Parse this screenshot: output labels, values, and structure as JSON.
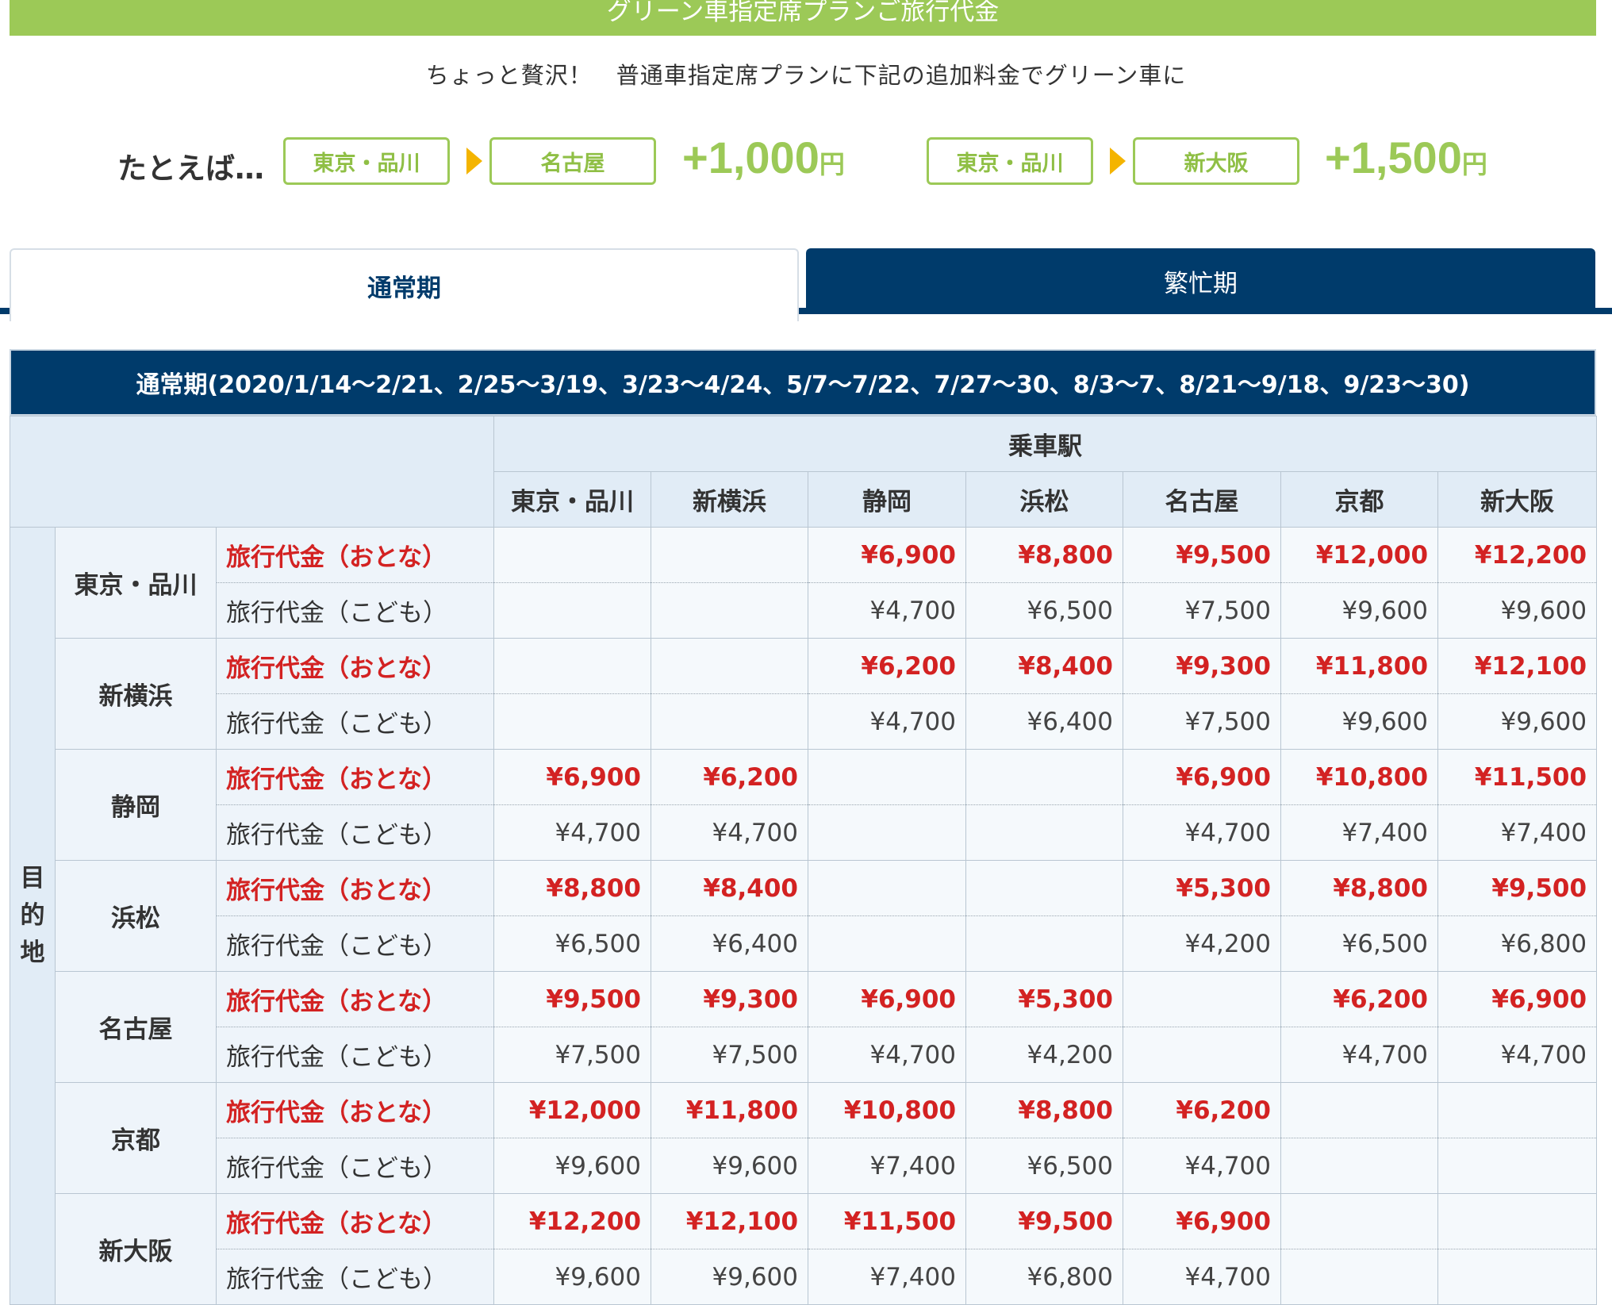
{
  "banner": {
    "title": "グリーン車指定席プランご旅行代金"
  },
  "subtitle": "ちょっと贅沢！　普通車指定席プランに下記の追加料金でグリーン車に",
  "example": {
    "label": "たとえば…",
    "routes": [
      {
        "from": "東京・品川",
        "to": "名古屋",
        "price": "+1,000",
        "unit": "円"
      },
      {
        "from": "東京・品川",
        "to": "新大阪",
        "price": "+1,500",
        "unit": "円"
      }
    ]
  },
  "tabs": [
    {
      "label": "通常期",
      "active": true
    },
    {
      "label": "繁忙期",
      "active": false
    }
  ],
  "table": {
    "period_title": "通常期(2020/1/14〜2/21、2/25〜3/19、3/23〜4/24、5/7〜7/22、7/27〜30、8/3〜7、8/21〜9/18、9/23〜30)",
    "boarding_label": "乗車駅",
    "destination_label": [
      "目",
      "的",
      "地"
    ],
    "columns": [
      "東京・品川",
      "新横浜",
      "静岡",
      "浜松",
      "名古屋",
      "京都",
      "新大阪"
    ],
    "adult_label": "旅行代金（おとな）",
    "child_label": "旅行代金（こども）",
    "rows": [
      {
        "station": "東京・品川",
        "adult": [
          "",
          "",
          "¥6,900",
          "¥8,800",
          "¥9,500",
          "¥12,000",
          "¥12,200"
        ],
        "child": [
          "",
          "",
          "¥4,700",
          "¥6,500",
          "¥7,500",
          "¥9,600",
          "¥9,600"
        ]
      },
      {
        "station": "新横浜",
        "adult": [
          "",
          "",
          "¥6,200",
          "¥8,400",
          "¥9,300",
          "¥11,800",
          "¥12,100"
        ],
        "child": [
          "",
          "",
          "¥4,700",
          "¥6,400",
          "¥7,500",
          "¥9,600",
          "¥9,600"
        ]
      },
      {
        "station": "静岡",
        "adult": [
          "¥6,900",
          "¥6,200",
          "",
          "",
          "¥6,900",
          "¥10,800",
          "¥11,500"
        ],
        "child": [
          "¥4,700",
          "¥4,700",
          "",
          "",
          "¥4,700",
          "¥7,400",
          "¥7,400"
        ]
      },
      {
        "station": "浜松",
        "adult": [
          "¥8,800",
          "¥8,400",
          "",
          "",
          "¥5,300",
          "¥8,800",
          "¥9,500"
        ],
        "child": [
          "¥6,500",
          "¥6,400",
          "",
          "",
          "¥4,200",
          "¥6,500",
          "¥6,800"
        ]
      },
      {
        "station": "名古屋",
        "adult": [
          "¥9,500",
          "¥9,300",
          "¥6,900",
          "¥5,300",
          "",
          "¥6,200",
          "¥6,900"
        ],
        "child": [
          "¥7,500",
          "¥7,500",
          "¥4,700",
          "¥4,200",
          "",
          "¥4,700",
          "¥4,700"
        ]
      },
      {
        "station": "京都",
        "adult": [
          "¥12,000",
          "¥11,800",
          "¥10,800",
          "¥8,800",
          "¥6,200",
          "",
          ""
        ],
        "child": [
          "¥9,600",
          "¥9,600",
          "¥7,400",
          "¥6,500",
          "¥4,700",
          "",
          ""
        ]
      },
      {
        "station": "新大阪",
        "adult": [
          "¥12,200",
          "¥12,100",
          "¥11,500",
          "¥9,500",
          "¥6,900",
          "",
          ""
        ],
        "child": [
          "¥9,600",
          "¥9,600",
          "¥7,400",
          "¥6,800",
          "¥4,700",
          "",
          ""
        ]
      }
    ]
  }
}
